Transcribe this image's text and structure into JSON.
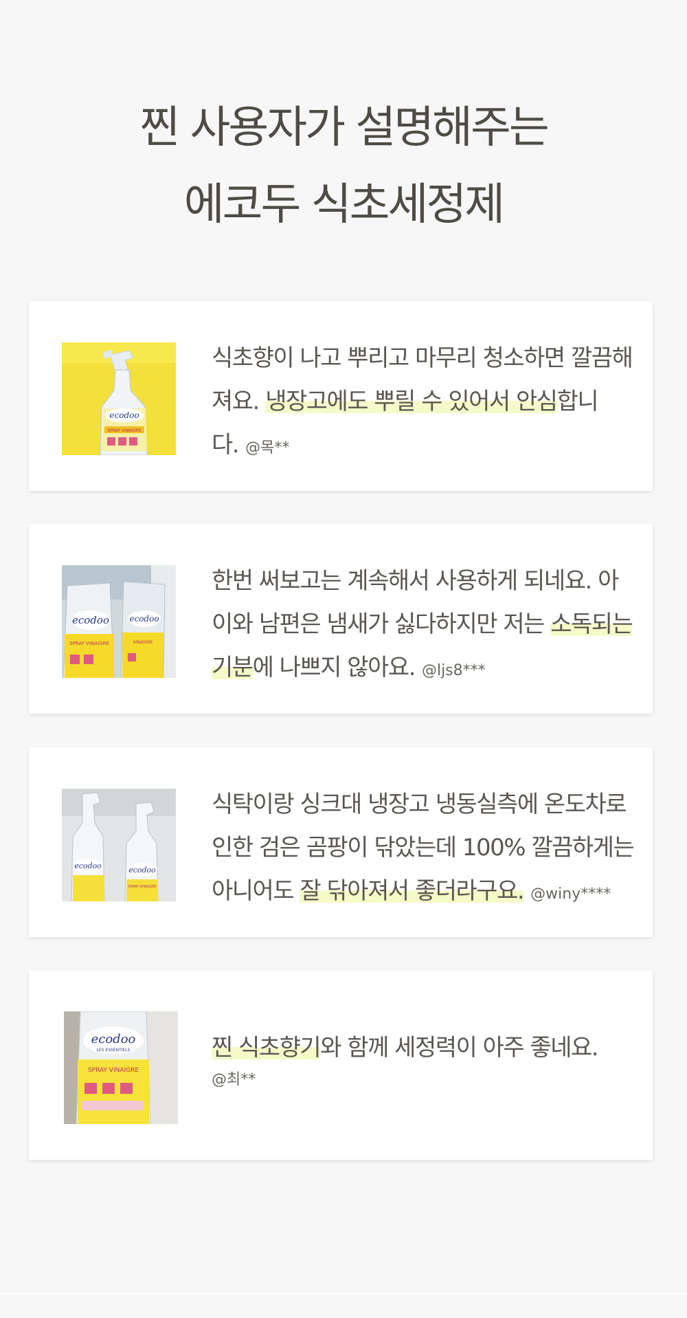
{
  "header": {
    "title_line1": "찐 사용자가 설명해주는",
    "title_line2": "에코두 식초세정제"
  },
  "reviews": [
    {
      "image_alt": "ecodoo spray vinaigre bottle on yellow background",
      "text_a": "식초향이 나고 뿌리고 마무리 청소하면 깔끔해져요. ",
      "highlight": "냉장고에도 뿌릴 수 있어서 안심",
      "text_b": "합니다.",
      "author": "@목**"
    },
    {
      "image_alt": "two ecodoo spray bottles",
      "text_a": "한번 써보고는 계속해서 사용하게 되네요. 아이와 남편은 냄새가 싫다하지만 저는 ",
      "highlight": "소독되는 기분",
      "text_b": "에 나쁘지 않아요.",
      "author": "@ljs8***"
    },
    {
      "image_alt": "two ecodoo spray bottles in sink",
      "text_a": "식탁이랑 싱크대 냉장고 냉동실측에 온도차로 인한 검은 곰팡이 닦았는데 100% 깔끔하게는 아니어도 ",
      "highlight": "잘 닦아져서 좋더라구요.",
      "text_b": "",
      "author": "@winy****"
    },
    {
      "image_alt": "ecodoo spray bottle close-up",
      "text_a": "",
      "highlight": "찐 식초향기",
      "text_b": "와 함께 세정력이 아주 좋네요.",
      "author": "@최**"
    }
  ],
  "colors": {
    "background": "#f7f7f7",
    "card": "#ffffff",
    "highlight": "#f4fbc8",
    "text": "#5b5752",
    "product_yellow": "#f5e23a"
  }
}
